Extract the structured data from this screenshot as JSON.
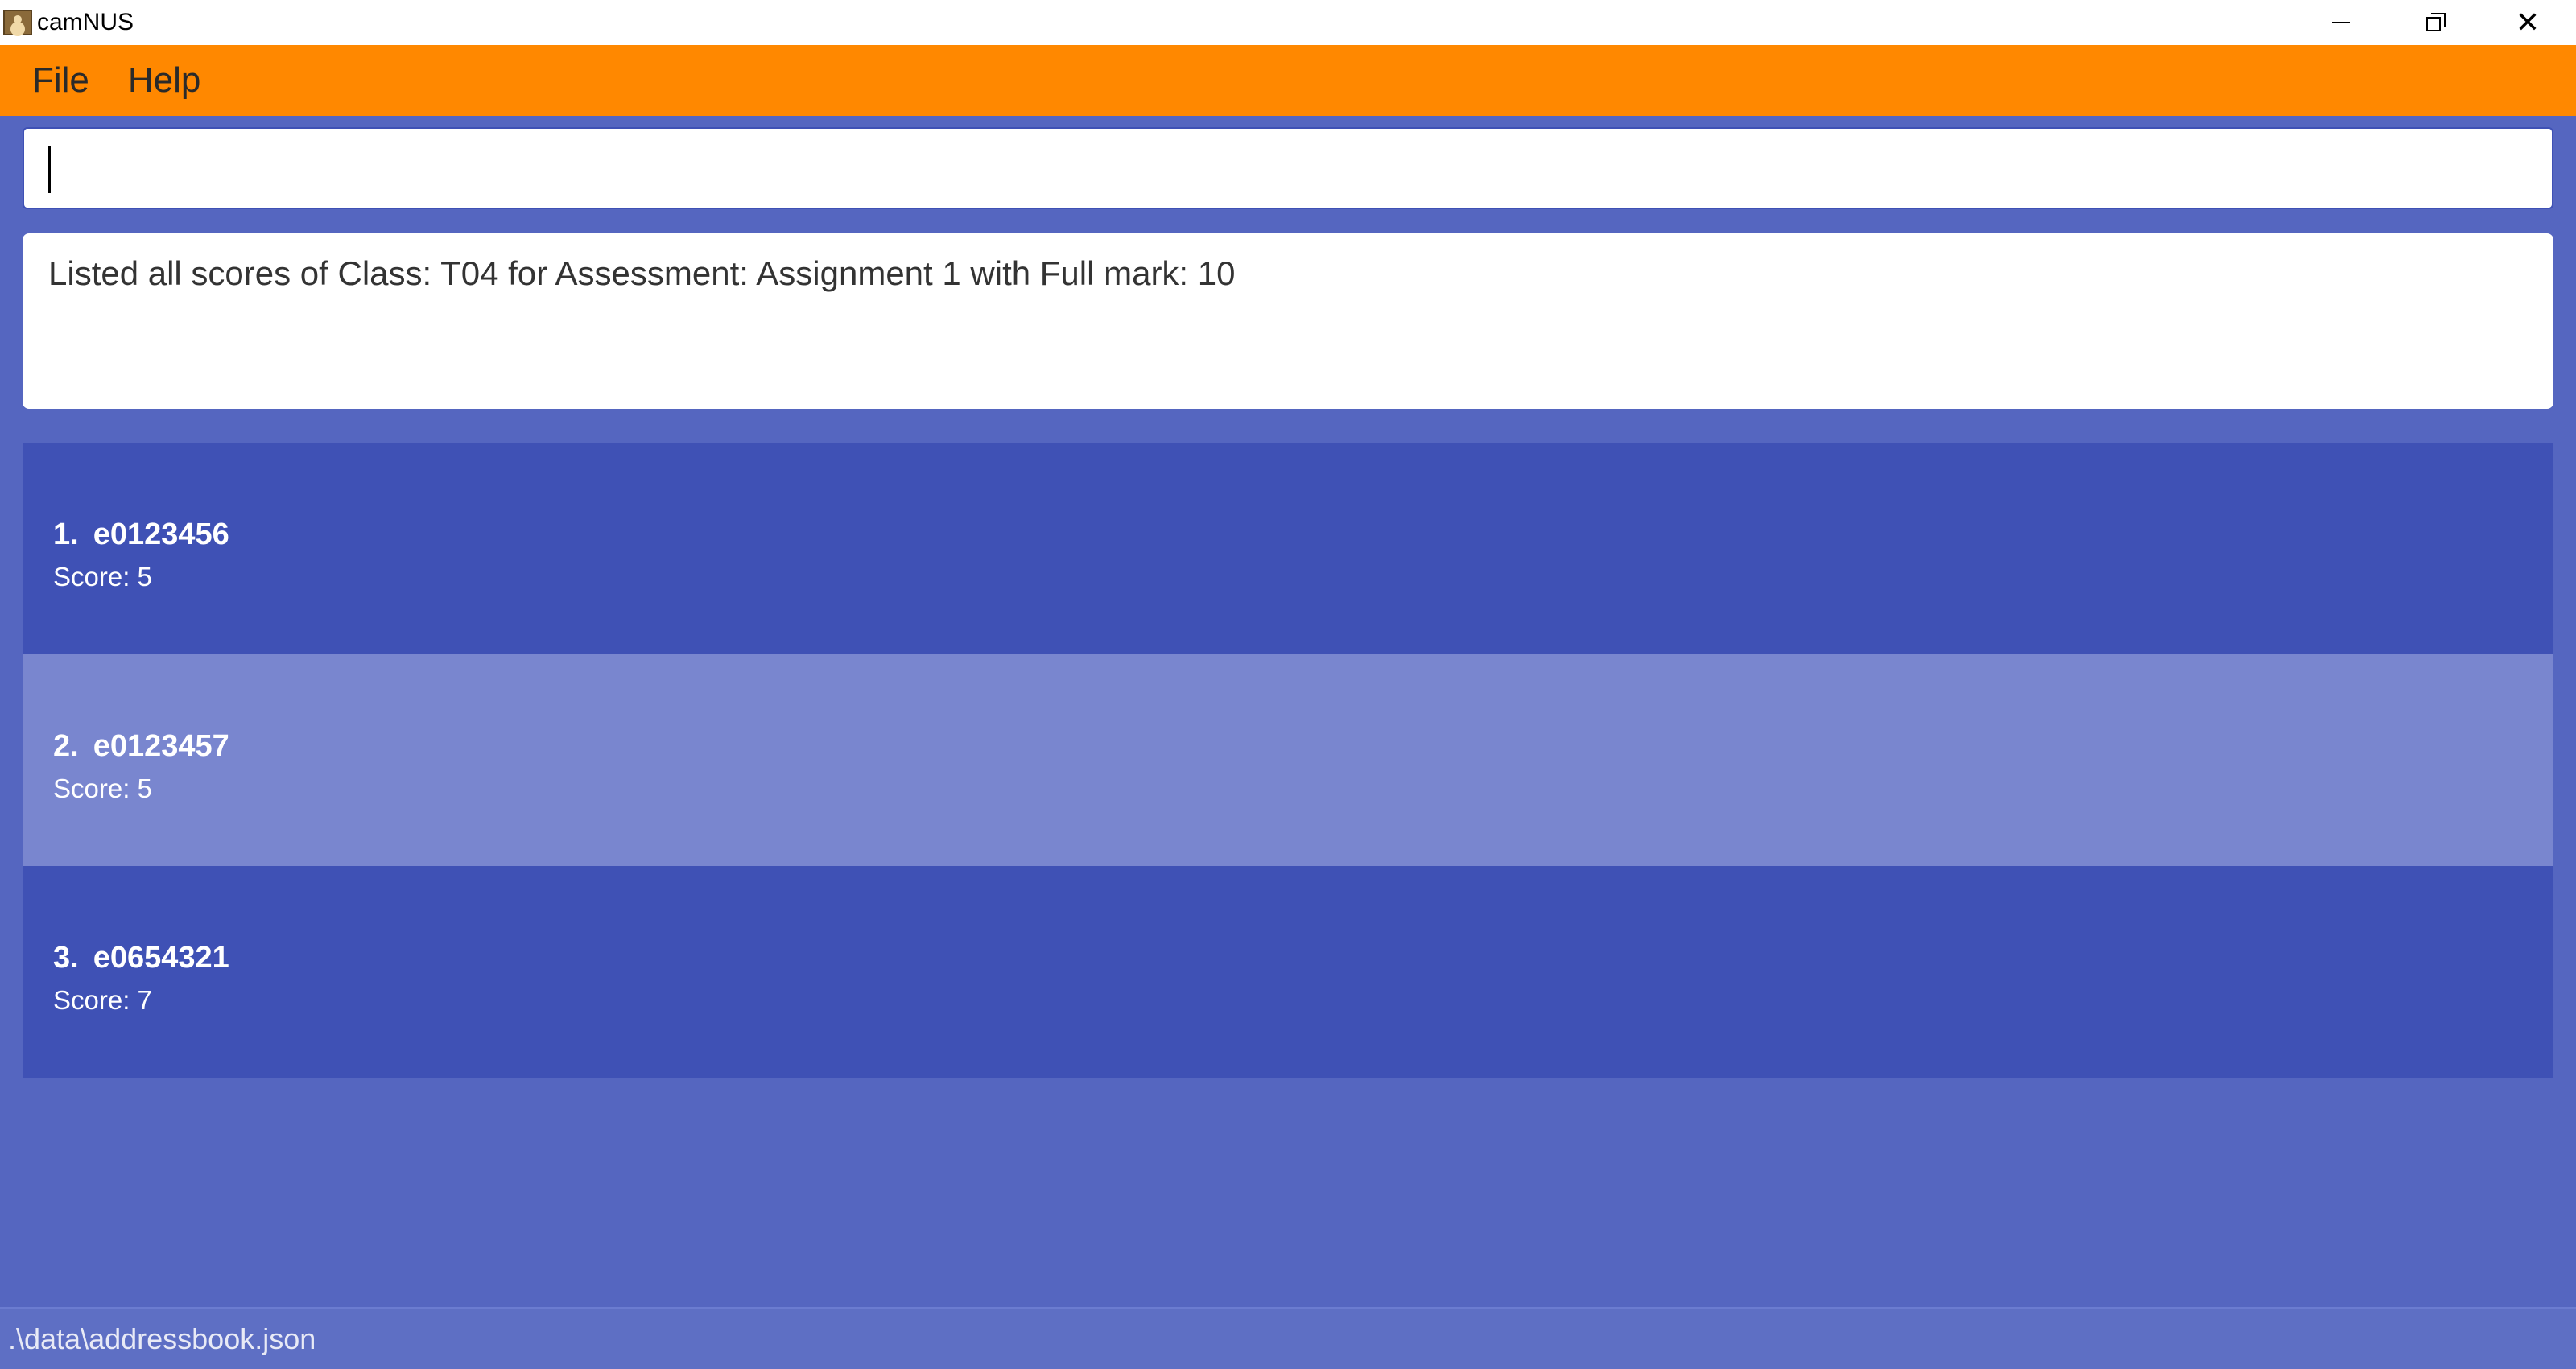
{
  "window": {
    "title": "camNUS",
    "close_glyph": "✕"
  },
  "menu": {
    "items": [
      {
        "label": "File"
      },
      {
        "label": "Help"
      }
    ]
  },
  "command": {
    "value": "",
    "placeholder": ""
  },
  "result": {
    "message": "Listed all scores of Class: T04 for Assessment: Assignment 1 with Full mark: 10"
  },
  "scores": [
    {
      "index": "1.",
      "id": "e0123456",
      "score": "Score: 5"
    },
    {
      "index": "2.",
      "id": "e0123457",
      "score": "Score: 5"
    },
    {
      "index": "3.",
      "id": "e0654321",
      "score": "Score: 7"
    }
  ],
  "status": {
    "path": ".\\data\\addressbook.json"
  },
  "colors": {
    "menu_bar": "#ff8800",
    "background": "#5566c0",
    "list_item": "#3f51b5",
    "list_item_selected": "#7986cf"
  }
}
